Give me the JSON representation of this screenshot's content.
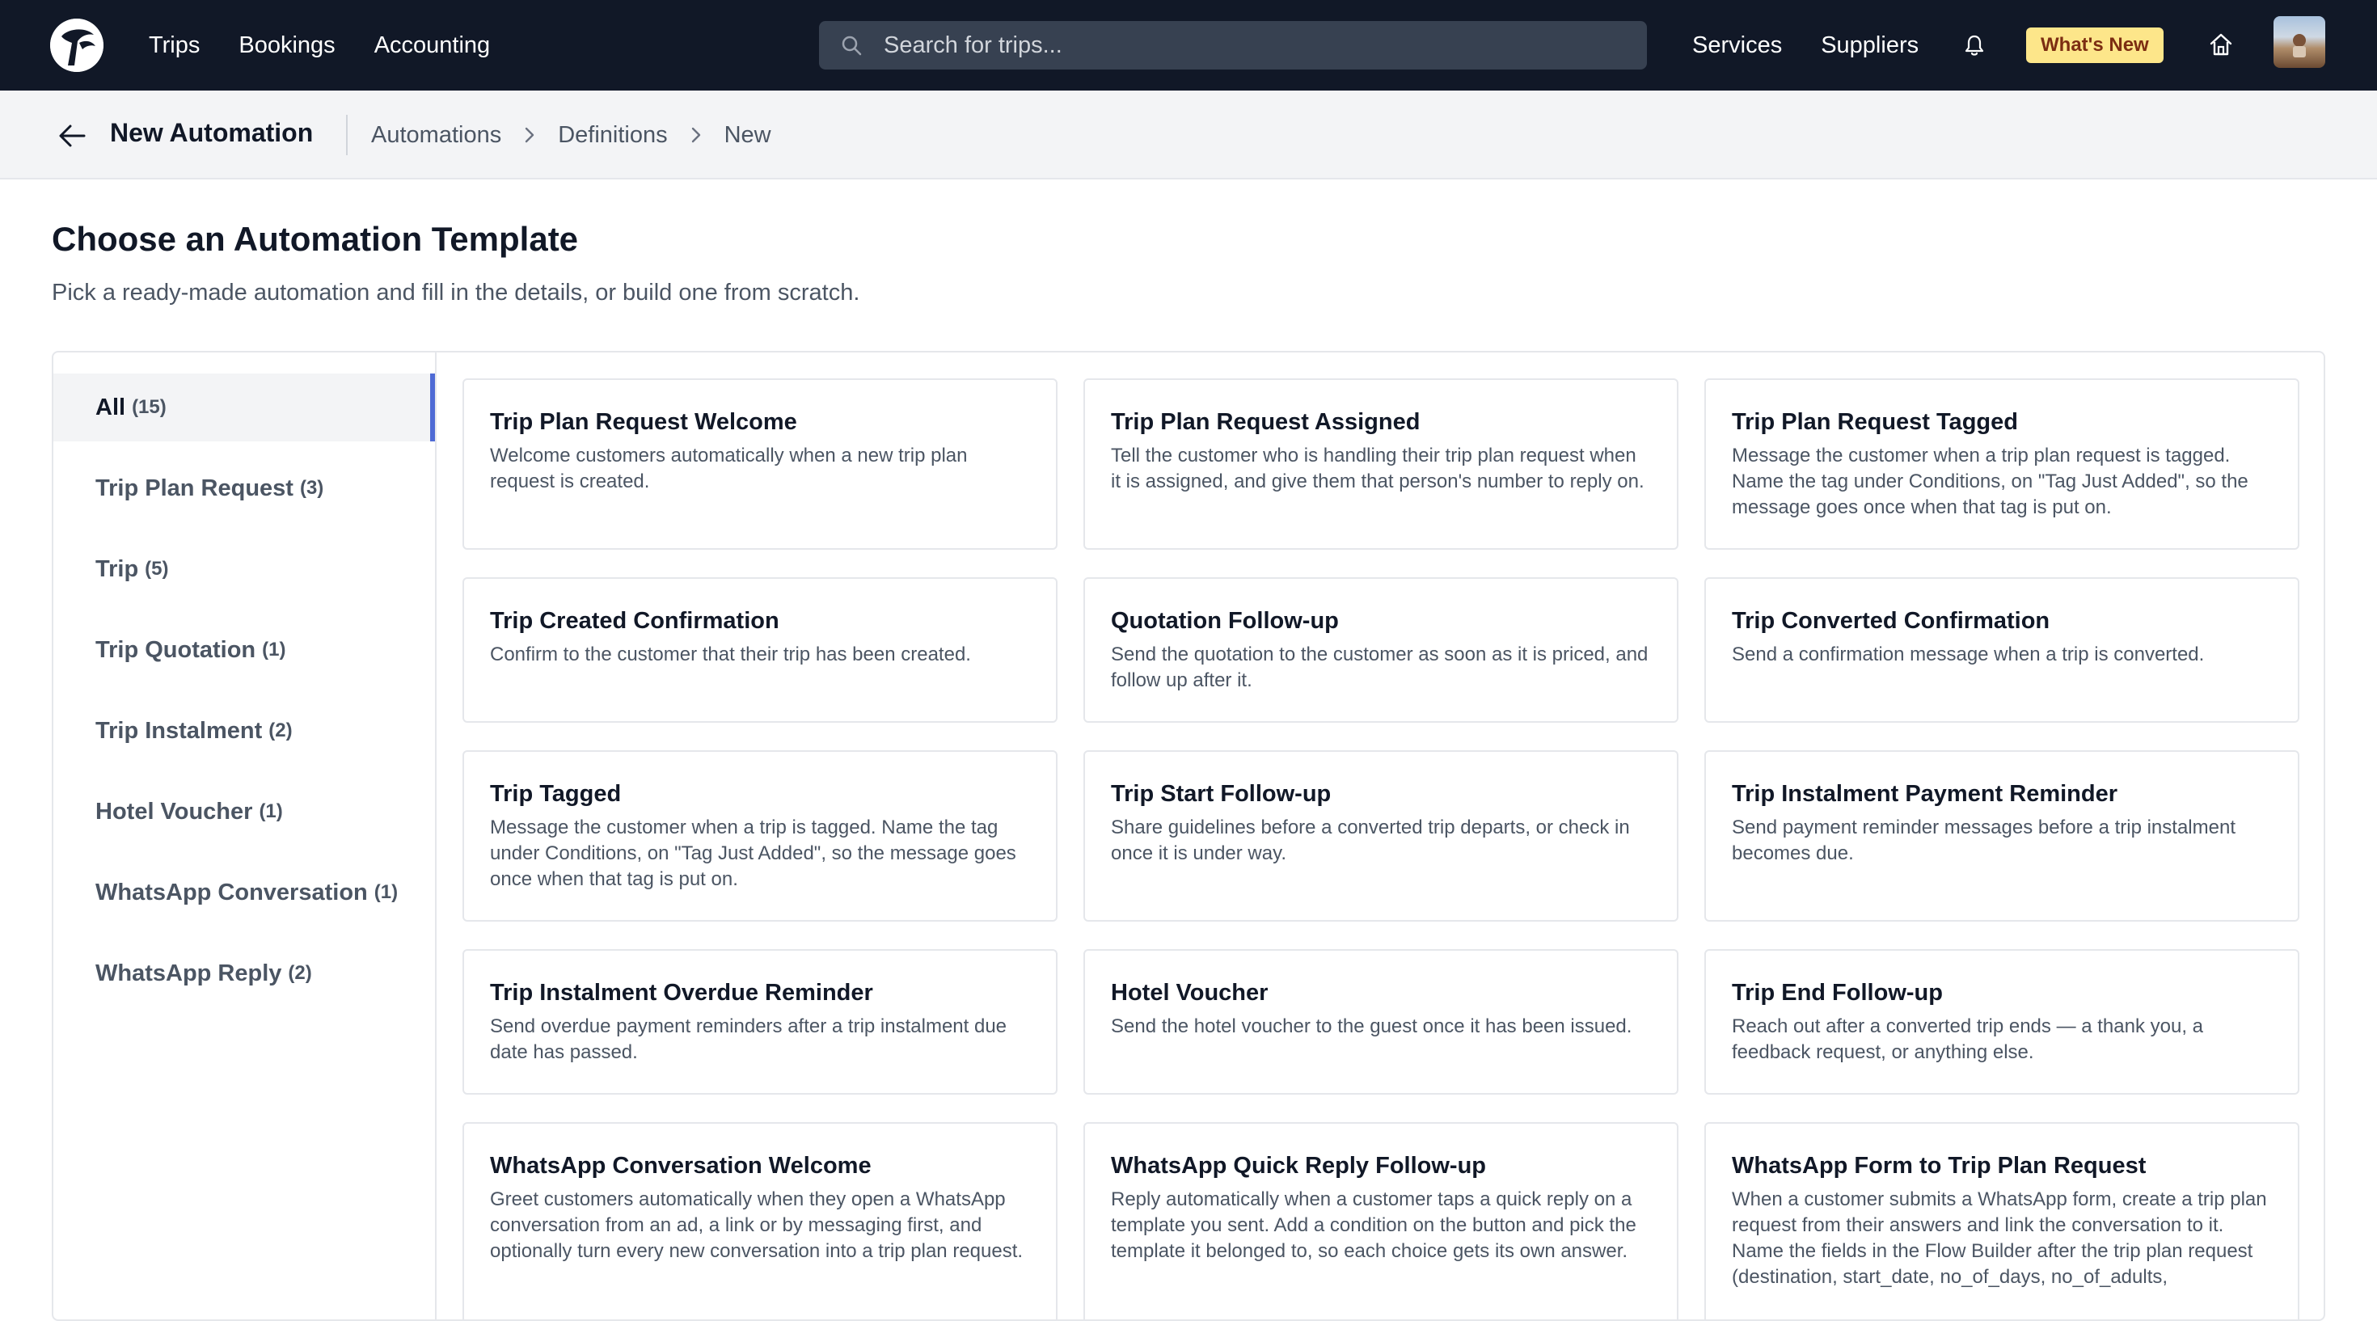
{
  "nav": {
    "links": [
      "Trips",
      "Bookings",
      "Accounting"
    ],
    "search_placeholder": "Search for trips...",
    "right_links": [
      "Services",
      "Suppliers"
    ],
    "whats_new": "What's New"
  },
  "subheader": {
    "title": "New Automation",
    "breadcrumbs": [
      "Automations",
      "Definitions",
      "New"
    ]
  },
  "page": {
    "title": "Choose an Automation Template",
    "subtitle": "Pick a ready-made automation and fill in the details, or build one from scratch."
  },
  "categories": [
    {
      "label": "All",
      "count": "(15)",
      "active": true
    },
    {
      "label": "Trip Plan Request",
      "count": "(3)"
    },
    {
      "label": "Trip",
      "count": "(5)"
    },
    {
      "label": "Trip Quotation",
      "count": "(1)"
    },
    {
      "label": "Trip Instalment",
      "count": "(2)"
    },
    {
      "label": "Hotel Voucher",
      "count": "(1)"
    },
    {
      "label": "WhatsApp Conversation",
      "count": "(1)"
    },
    {
      "label": "WhatsApp Reply",
      "count": "(2)"
    }
  ],
  "templates": [
    {
      "title": "Trip Plan Request Welcome",
      "description": "Welcome customers automatically when a new trip plan request is created."
    },
    {
      "title": "Trip Plan Request Assigned",
      "description": "Tell the customer who is handling their trip plan request when it is assigned, and give them that person's number to reply on."
    },
    {
      "title": "Trip Plan Request Tagged",
      "description": "Message the customer when a trip plan request is tagged. Name the tag under Conditions, on \"Tag Just Added\", so the message goes once when that tag is put on."
    },
    {
      "title": "Trip Created Confirmation",
      "description": "Confirm to the customer that their trip has been created."
    },
    {
      "title": "Quotation Follow-up",
      "description": "Send the quotation to the customer as soon as it is priced, and follow up after it."
    },
    {
      "title": "Trip Converted Confirmation",
      "description": "Send a confirmation message when a trip is converted."
    },
    {
      "title": "Trip Tagged",
      "description": "Message the customer when a trip is tagged. Name the tag under Conditions, on \"Tag Just Added\", so the message goes once when that tag is put on."
    },
    {
      "title": "Trip Start Follow-up",
      "description": "Share guidelines before a converted trip departs, or check in once it is under way."
    },
    {
      "title": "Trip Instalment Payment Reminder",
      "description": "Send payment reminder messages before a trip instalment becomes due."
    },
    {
      "title": "Trip Instalment Overdue Reminder",
      "description": "Send overdue payment reminders after a trip instalment due date has passed."
    },
    {
      "title": "Hotel Voucher",
      "description": "Send the hotel voucher to the guest once it has been issued."
    },
    {
      "title": "Trip End Follow-up",
      "description": "Reach out after a converted trip ends — a thank you, a feedback request, or anything else."
    },
    {
      "title": "WhatsApp Conversation Welcome",
      "description": "Greet customers automatically when they open a WhatsApp conversation from an ad, a link or by messaging first, and optionally turn every new conversation into a trip plan request."
    },
    {
      "title": "WhatsApp Quick Reply Follow-up",
      "description": "Reply automatically when a customer taps a quick reply on a template you sent. Add a condition on the button and pick the template it belonged to, so each choice gets its own answer."
    },
    {
      "title": "WhatsApp Form to Trip Plan Request",
      "description": "When a customer submits a WhatsApp form, create a trip plan request from their answers and link the conversation to it. Name the fields in the Flow Builder after the trip plan request (destination, start_date, no_of_days, no_of_adults,"
    }
  ],
  "colors": {
    "navbar": "#111827",
    "accent": "#4f6bd5",
    "whats_new_bg": "#fde68a"
  }
}
